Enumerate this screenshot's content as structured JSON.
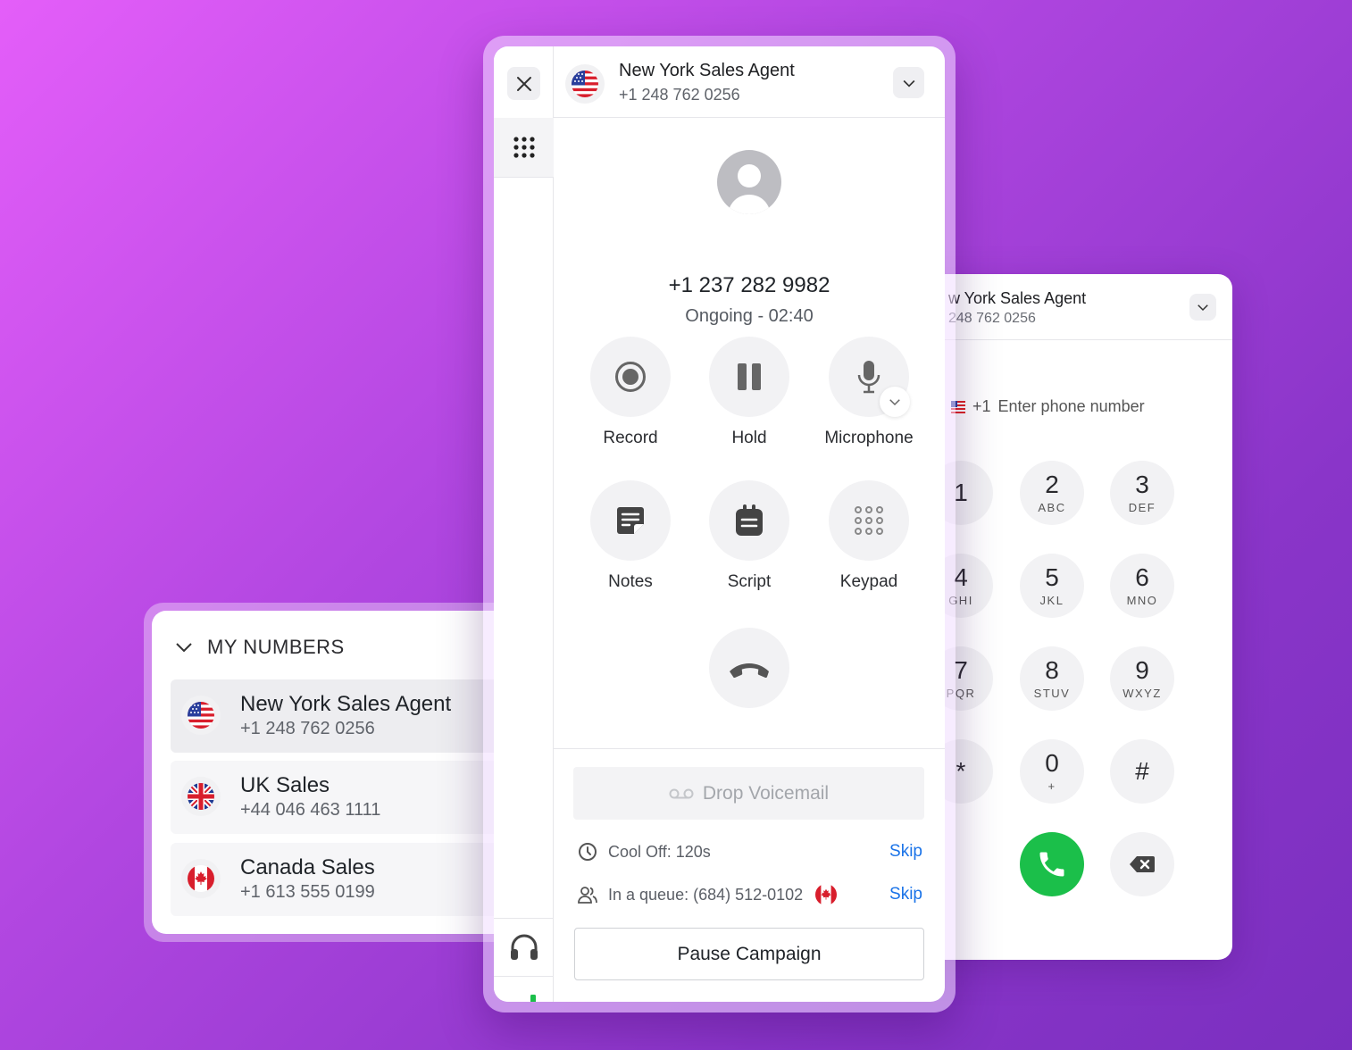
{
  "dialer": {
    "header_title": "w York Sales Agent",
    "header_number": "248 762 0256",
    "country_code": "+1",
    "input_placeholder": "Enter phone number",
    "keys": [
      {
        "digit": "1",
        "letters": ""
      },
      {
        "digit": "2",
        "letters": "ABC"
      },
      {
        "digit": "3",
        "letters": "DEF"
      },
      {
        "digit": "4",
        "letters": "GHI"
      },
      {
        "digit": "5",
        "letters": "JKL"
      },
      {
        "digit": "6",
        "letters": "MNO"
      },
      {
        "digit": "7",
        "letters": "PQR"
      },
      {
        "digit": "8",
        "letters": "STUV"
      },
      {
        "digit": "9",
        "letters": "WXYZ"
      },
      {
        "digit": "*",
        "letters": ""
      },
      {
        "digit": "0",
        "letters": "+"
      },
      {
        "digit": "#",
        "letters": ""
      }
    ],
    "call_color": "#1bbf4a"
  },
  "numbers": {
    "heading": "MY NUMBERS",
    "items": [
      {
        "name": "New York Sales Agent",
        "number": "+1 248 762 0256",
        "flag": "us-flag-icon"
      },
      {
        "name": "UK Sales",
        "number": "+44 046 463 1111",
        "flag": "uk-flag-icon"
      },
      {
        "name": "Canada Sales",
        "number": "+1 613 555 0199",
        "flag": "canada-flag-icon"
      }
    ]
  },
  "main": {
    "header_title": "New York Sales Agent",
    "header_number": "+1 248 762 0256",
    "caller_number": "+1 237 282 9982",
    "call_status": "Ongoing - 02:40",
    "actions": [
      {
        "label": "Record",
        "icon": "record-icon"
      },
      {
        "label": "Hold",
        "icon": "pause-icon"
      },
      {
        "label": "Microphone",
        "icon": "microphone-icon"
      },
      {
        "label": "Notes",
        "icon": "notes-icon"
      },
      {
        "label": "Script",
        "icon": "script-icon"
      },
      {
        "label": "Keypad",
        "icon": "keypad-icon"
      }
    ],
    "drop_voicemail": "Drop Voicemail",
    "cool_off": "Cool Off: 120s",
    "queue": "In a queue: (684) 512-0102",
    "skip_label": "Skip",
    "pause_campaign": "Pause Campaign",
    "signal_color": "#1bbf4a",
    "link_color": "#1a73e8"
  }
}
